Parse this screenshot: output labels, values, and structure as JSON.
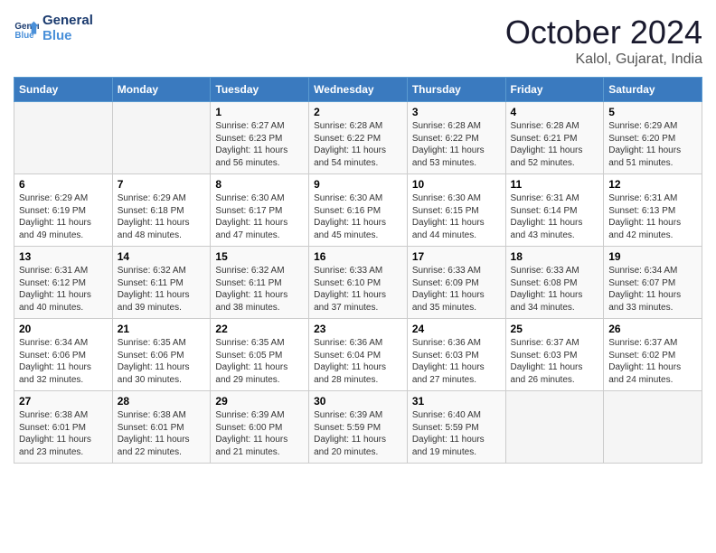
{
  "header": {
    "logo_line1": "General",
    "logo_line2": "Blue",
    "month_title": "October 2024",
    "location": "Kalol, Gujarat, India"
  },
  "weekdays": [
    "Sunday",
    "Monday",
    "Tuesday",
    "Wednesday",
    "Thursday",
    "Friday",
    "Saturday"
  ],
  "weeks": [
    [
      {
        "day": "",
        "info": ""
      },
      {
        "day": "",
        "info": ""
      },
      {
        "day": "1",
        "info": "Sunrise: 6:27 AM\nSunset: 6:23 PM\nDaylight: 11 hours and 56 minutes."
      },
      {
        "day": "2",
        "info": "Sunrise: 6:28 AM\nSunset: 6:22 PM\nDaylight: 11 hours and 54 minutes."
      },
      {
        "day": "3",
        "info": "Sunrise: 6:28 AM\nSunset: 6:22 PM\nDaylight: 11 hours and 53 minutes."
      },
      {
        "day": "4",
        "info": "Sunrise: 6:28 AM\nSunset: 6:21 PM\nDaylight: 11 hours and 52 minutes."
      },
      {
        "day": "5",
        "info": "Sunrise: 6:29 AM\nSunset: 6:20 PM\nDaylight: 11 hours and 51 minutes."
      }
    ],
    [
      {
        "day": "6",
        "info": "Sunrise: 6:29 AM\nSunset: 6:19 PM\nDaylight: 11 hours and 49 minutes."
      },
      {
        "day": "7",
        "info": "Sunrise: 6:29 AM\nSunset: 6:18 PM\nDaylight: 11 hours and 48 minutes."
      },
      {
        "day": "8",
        "info": "Sunrise: 6:30 AM\nSunset: 6:17 PM\nDaylight: 11 hours and 47 minutes."
      },
      {
        "day": "9",
        "info": "Sunrise: 6:30 AM\nSunset: 6:16 PM\nDaylight: 11 hours and 45 minutes."
      },
      {
        "day": "10",
        "info": "Sunrise: 6:30 AM\nSunset: 6:15 PM\nDaylight: 11 hours and 44 minutes."
      },
      {
        "day": "11",
        "info": "Sunrise: 6:31 AM\nSunset: 6:14 PM\nDaylight: 11 hours and 43 minutes."
      },
      {
        "day": "12",
        "info": "Sunrise: 6:31 AM\nSunset: 6:13 PM\nDaylight: 11 hours and 42 minutes."
      }
    ],
    [
      {
        "day": "13",
        "info": "Sunrise: 6:31 AM\nSunset: 6:12 PM\nDaylight: 11 hours and 40 minutes."
      },
      {
        "day": "14",
        "info": "Sunrise: 6:32 AM\nSunset: 6:11 PM\nDaylight: 11 hours and 39 minutes."
      },
      {
        "day": "15",
        "info": "Sunrise: 6:32 AM\nSunset: 6:11 PM\nDaylight: 11 hours and 38 minutes."
      },
      {
        "day": "16",
        "info": "Sunrise: 6:33 AM\nSunset: 6:10 PM\nDaylight: 11 hours and 37 minutes."
      },
      {
        "day": "17",
        "info": "Sunrise: 6:33 AM\nSunset: 6:09 PM\nDaylight: 11 hours and 35 minutes."
      },
      {
        "day": "18",
        "info": "Sunrise: 6:33 AM\nSunset: 6:08 PM\nDaylight: 11 hours and 34 minutes."
      },
      {
        "day": "19",
        "info": "Sunrise: 6:34 AM\nSunset: 6:07 PM\nDaylight: 11 hours and 33 minutes."
      }
    ],
    [
      {
        "day": "20",
        "info": "Sunrise: 6:34 AM\nSunset: 6:06 PM\nDaylight: 11 hours and 32 minutes."
      },
      {
        "day": "21",
        "info": "Sunrise: 6:35 AM\nSunset: 6:06 PM\nDaylight: 11 hours and 30 minutes."
      },
      {
        "day": "22",
        "info": "Sunrise: 6:35 AM\nSunset: 6:05 PM\nDaylight: 11 hours and 29 minutes."
      },
      {
        "day": "23",
        "info": "Sunrise: 6:36 AM\nSunset: 6:04 PM\nDaylight: 11 hours and 28 minutes."
      },
      {
        "day": "24",
        "info": "Sunrise: 6:36 AM\nSunset: 6:03 PM\nDaylight: 11 hours and 27 minutes."
      },
      {
        "day": "25",
        "info": "Sunrise: 6:37 AM\nSunset: 6:03 PM\nDaylight: 11 hours and 26 minutes."
      },
      {
        "day": "26",
        "info": "Sunrise: 6:37 AM\nSunset: 6:02 PM\nDaylight: 11 hours and 24 minutes."
      }
    ],
    [
      {
        "day": "27",
        "info": "Sunrise: 6:38 AM\nSunset: 6:01 PM\nDaylight: 11 hours and 23 minutes."
      },
      {
        "day": "28",
        "info": "Sunrise: 6:38 AM\nSunset: 6:01 PM\nDaylight: 11 hours and 22 minutes."
      },
      {
        "day": "29",
        "info": "Sunrise: 6:39 AM\nSunset: 6:00 PM\nDaylight: 11 hours and 21 minutes."
      },
      {
        "day": "30",
        "info": "Sunrise: 6:39 AM\nSunset: 5:59 PM\nDaylight: 11 hours and 20 minutes."
      },
      {
        "day": "31",
        "info": "Sunrise: 6:40 AM\nSunset: 5:59 PM\nDaylight: 11 hours and 19 minutes."
      },
      {
        "day": "",
        "info": ""
      },
      {
        "day": "",
        "info": ""
      }
    ]
  ]
}
